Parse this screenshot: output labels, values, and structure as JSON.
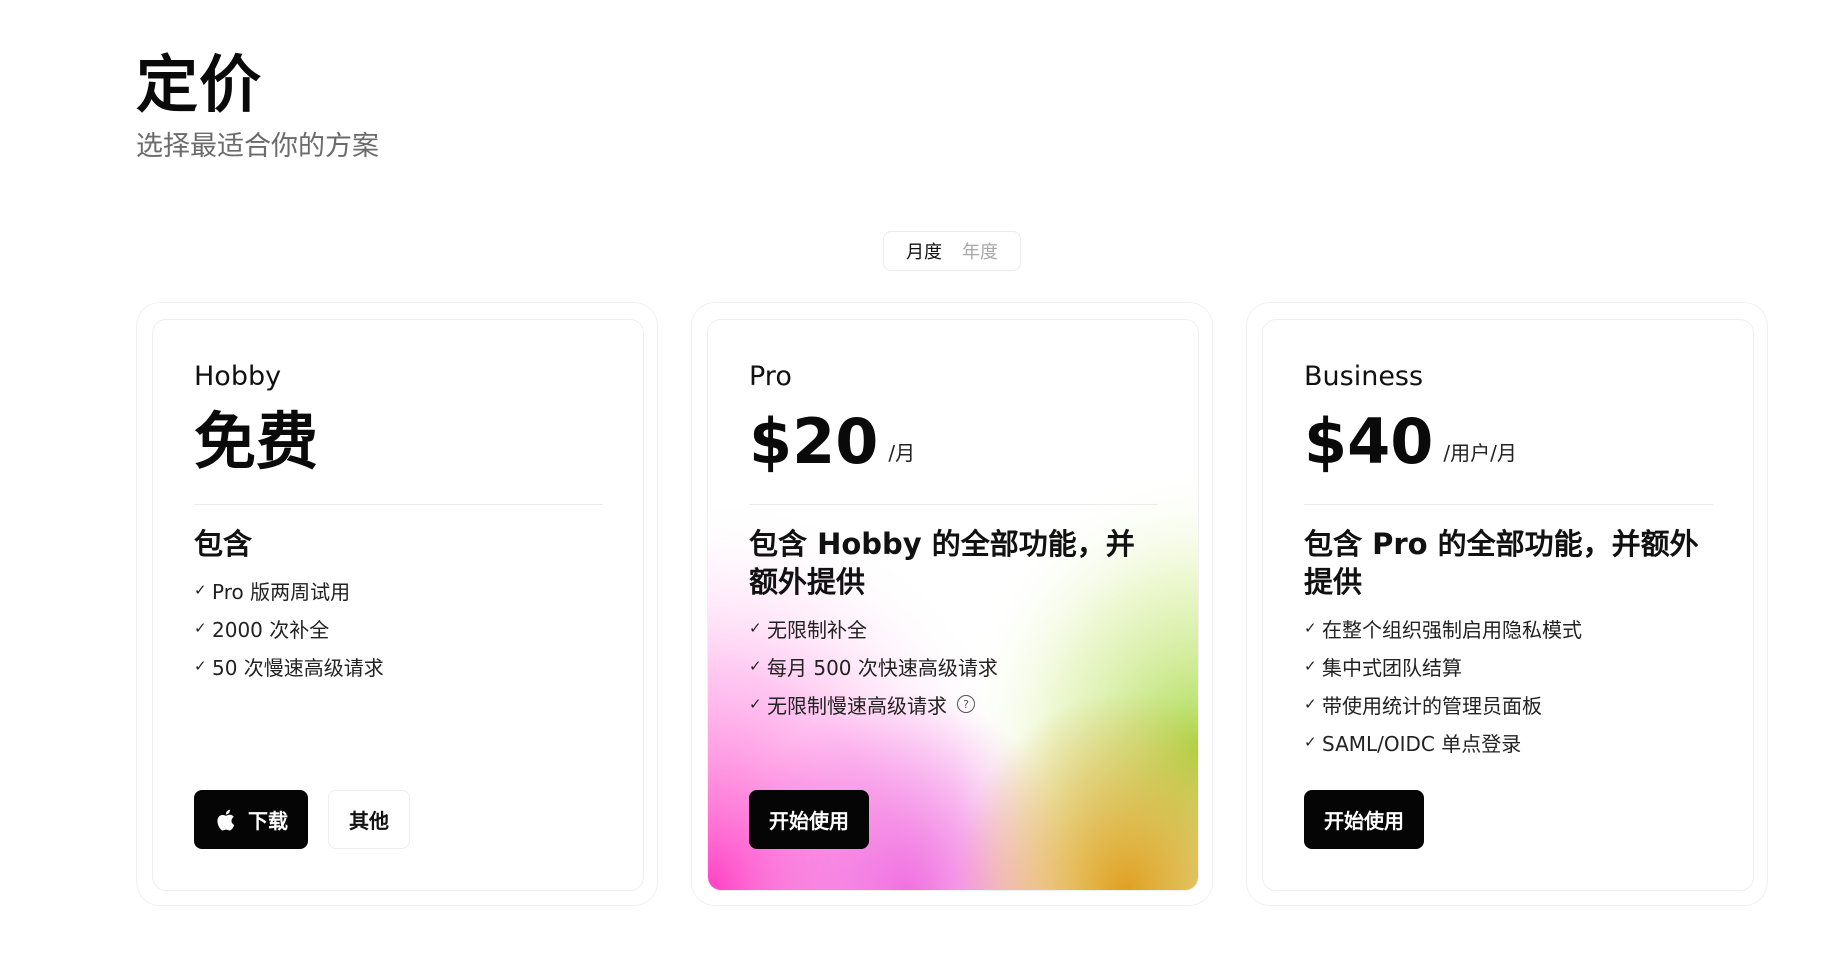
{
  "header": {
    "title": "定价",
    "subtitle": "选择最适合你的方案"
  },
  "billing_toggle": {
    "monthly": "月度",
    "yearly": "年度",
    "selected": "月度"
  },
  "plans": [
    {
      "name": "Hobby",
      "price": "免费",
      "unit": "",
      "includes_heading": "包含",
      "features": [
        "Pro 版两周试用",
        "2000 次补全",
        "50 次慢速高级请求"
      ],
      "primary_button": "下载",
      "primary_icon": "apple-icon",
      "secondary_button": "其他"
    },
    {
      "name": "Pro",
      "price": "$20",
      "unit": "/月",
      "includes_heading": "包含 Hobby 的全部功能，并额外提供",
      "features": [
        "无限制补全",
        "每月 500 次快速高级请求",
        "无限制慢速高级请求"
      ],
      "info_icon_feature": "无限制慢速高级请求",
      "primary_button": "开始使用"
    },
    {
      "name": "Business",
      "price": "$40",
      "unit": "/用户/月",
      "includes_heading": "包含 Pro 的全部功能，并额外提供",
      "features": [
        "在整个组织强制启用隐私模式",
        "集中式团队结算",
        "带使用统计的管理员面板",
        "SAML/OIDC 单点登录"
      ],
      "primary_button": "开始使用"
    }
  ],
  "icons": {
    "check": "check-icon",
    "info": "info-icon"
  },
  "colors": {
    "button_bg": "#050505",
    "pro_gradient": [
      "#ff3fc4",
      "#f59ae8",
      "#c8e87a",
      "#e8a02a"
    ]
  }
}
